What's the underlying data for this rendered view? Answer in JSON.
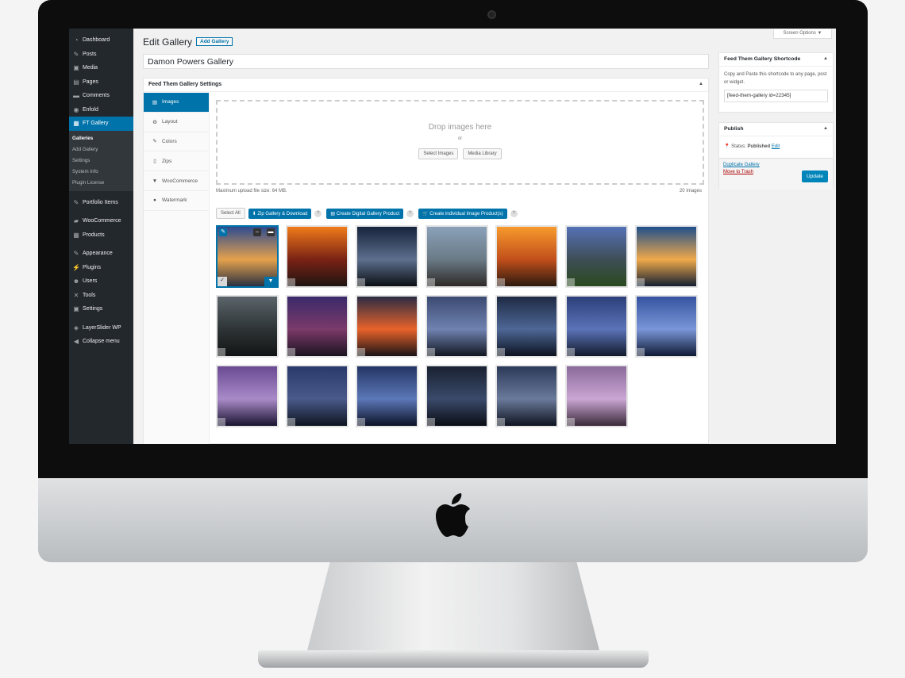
{
  "nav": {
    "items": [
      {
        "label": "Dashboard",
        "icon": "dashboard-icon"
      },
      {
        "label": "Posts",
        "icon": "pin-icon"
      },
      {
        "label": "Media",
        "icon": "media-icon"
      },
      {
        "label": "Pages",
        "icon": "pages-icon"
      },
      {
        "label": "Comments",
        "icon": "comments-icon"
      },
      {
        "label": "Enfold",
        "icon": "enfold-icon"
      },
      {
        "label": "FT Gallery",
        "icon": "gallery-icon"
      }
    ],
    "sub_items": [
      "Galleries",
      "Add Gallery",
      "Settings",
      "System Info",
      "Plugin License"
    ],
    "items2": [
      {
        "label": "Portfolio Items",
        "icon": "pin-icon"
      },
      {
        "label": "WooCommerce",
        "icon": "woocommerce-icon"
      },
      {
        "label": "Products",
        "icon": "products-icon"
      },
      {
        "label": "Appearance",
        "icon": "brush-icon"
      },
      {
        "label": "Plugins",
        "icon": "plugin-icon"
      },
      {
        "label": "Users",
        "icon": "users-icon"
      },
      {
        "label": "Tools",
        "icon": "wrench-icon"
      },
      {
        "label": "Settings",
        "icon": "settings-icon"
      },
      {
        "label": "LayerSlider WP",
        "icon": "layerslider-icon"
      },
      {
        "label": "Collapse menu",
        "icon": "collapse-icon"
      }
    ]
  },
  "header": {
    "title": "Edit Gallery",
    "add_label": "Add Gallery",
    "screen_options": "Screen Options ▼",
    "gallery_name": "Damon Powers Gallery"
  },
  "settings": {
    "heading": "Feed Them Gallery Settings",
    "tabs": [
      {
        "label": "Images",
        "icon": "image-icon"
      },
      {
        "label": "Layout",
        "icon": "gear-icon"
      },
      {
        "label": "Colors",
        "icon": "brush-icon"
      },
      {
        "label": "Zips",
        "icon": "zip-icon"
      },
      {
        "label": "WooCommerce",
        "icon": "cart-icon"
      },
      {
        "label": "Watermark",
        "icon": "drop-icon"
      }
    ],
    "drop_text": "Drop images here",
    "or": "or",
    "select_images": "Select Images",
    "media_library": "Media Library",
    "max_upload": "Maximum upload file size: 64 MB.",
    "image_count": "20 Images",
    "select_all": "Select All",
    "zip_download": "Zip Gallery & Download",
    "create_digital": "Create Digital Gallery Product",
    "create_individual": "Create individual Image Product(s)",
    "help": "?"
  },
  "images": [
    {
      "name": "blue-sky-sunset",
      "colors": [
        "#2d4b8f",
        "#e5a14c",
        "#2b3140"
      ]
    },
    {
      "name": "orange-sunset-beach",
      "colors": [
        "#f07b1b",
        "#7a2214",
        "#1f1412"
      ]
    },
    {
      "name": "lighthouse-milky-way",
      "colors": [
        "#16233c",
        "#5c6f8d",
        "#0b0f14"
      ]
    },
    {
      "name": "rocky-shore",
      "colors": [
        "#8aa1b9",
        "#6a7a86",
        "#2e2a28"
      ]
    },
    {
      "name": "pier-sunset",
      "colors": [
        "#f79a2d",
        "#c24f1b",
        "#2c1a0f"
      ]
    },
    {
      "name": "lily-pads",
      "colors": [
        "#5571b6",
        "#3e4e56",
        "#2a4a1e"
      ]
    },
    {
      "name": "palm-sunset",
      "colors": [
        "#1e4f8c",
        "#f0a94a",
        "#142032"
      ]
    },
    {
      "name": "driftwood-beach",
      "colors": [
        "#5a646a",
        "#2e3436",
        "#111414"
      ]
    },
    {
      "name": "hut-milky-way",
      "colors": [
        "#3a2a6a",
        "#7b3a6a",
        "#1b1320"
      ]
    },
    {
      "name": "fiery-sky",
      "colors": [
        "#2b2c44",
        "#e8622a",
        "#1a1416"
      ]
    },
    {
      "name": "pier-lightning",
      "colors": [
        "#3b4a72",
        "#6f82b0",
        "#121722"
      ]
    },
    {
      "name": "storm-cloud",
      "colors": [
        "#1e2a44",
        "#4e6796",
        "#0c1220"
      ]
    },
    {
      "name": "multi-lightning",
      "colors": [
        "#2c3f7a",
        "#5b73b8",
        "#121a2c"
      ]
    },
    {
      "name": "lightning-tower",
      "colors": [
        "#3553a0",
        "#7a96d8",
        "#0f1a35"
      ]
    },
    {
      "name": "purple-lightning-lake",
      "colors": [
        "#6a4a92",
        "#a98ac8",
        "#1a1430"
      ]
    },
    {
      "name": "milky-way-grass",
      "colors": [
        "#2a3a6a",
        "#4a5a8a",
        "#0e1420"
      ]
    },
    {
      "name": "blue-lightning-city",
      "colors": [
        "#243564",
        "#5c78b8",
        "#0c1226"
      ]
    },
    {
      "name": "car-milky-way",
      "colors": [
        "#1a2232",
        "#3a4a6a",
        "#0a0d14"
      ]
    },
    {
      "name": "tree-milky-way",
      "colors": [
        "#2c3a5a",
        "#6a7a9a",
        "#0e1320"
      ]
    },
    {
      "name": "pink-lightning-road",
      "colors": [
        "#8a6a9a",
        "#caa6d4",
        "#3a2a3a"
      ]
    }
  ],
  "shortcode_box": {
    "title": "Feed Them Gallery Shortcode",
    "desc": "Copy and Paste this shortcode to any page, post or widget.",
    "value": "[feed-them-gallery id=22345]"
  },
  "publish_box": {
    "title": "Publish",
    "status_label": "Status:",
    "status_value": "Published",
    "edit": "Edit",
    "duplicate": "Duplicate Gallery",
    "trash": "Move to Trash",
    "update": "Update"
  },
  "colors": {
    "accent": "#0073aa",
    "nav_bg": "#23282d",
    "trash": "#a00"
  }
}
